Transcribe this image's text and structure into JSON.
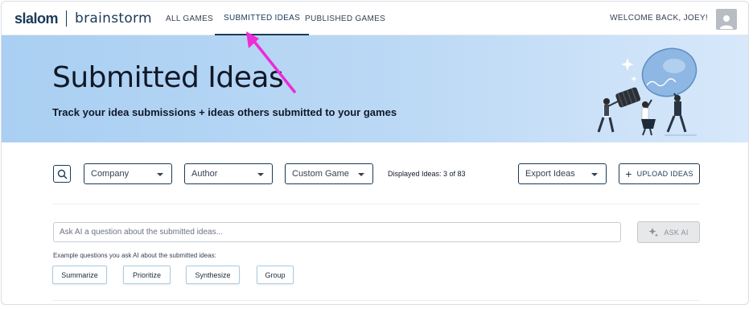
{
  "brand": {
    "name_left": "slalom",
    "name_right": "brainstorm"
  },
  "nav": {
    "tabs": [
      {
        "label": "ALL GAMES",
        "active": false
      },
      {
        "label": "SUBMITTED IDEAS",
        "active": true
      },
      {
        "label": "PUBLISHED GAMES",
        "active": false
      }
    ],
    "welcome": "WELCOME BACK, JOEY!",
    "avatar_icon": "user-avatar-icon"
  },
  "hero": {
    "title": "Submitted Ideas",
    "subtitle": "Track your idea submissions + ideas others submitted to your games",
    "illustration": "people-carrying-lightbulb"
  },
  "filters": {
    "search_icon": "search-icon",
    "company": "Company",
    "author": "Author",
    "game": "Custom Game",
    "displayed": "Displayed Ideas: 3 of 83",
    "export": "Export Ideas",
    "upload": "UPLOAD IDEAS"
  },
  "ask_ai": {
    "placeholder": "Ask AI a question about the submitted ideas...",
    "button": "ASK AI",
    "examples_label": "Example questions you ask AI about the submitted ideas:",
    "examples": [
      "Summarize",
      "Prioritize",
      "Synthesize",
      "Group"
    ]
  },
  "colors": {
    "brand_navy": "#1b3a57",
    "hero_blue": "#a9cff2",
    "annotation_magenta": "#ee2bd6",
    "chip_border": "#a9cbe5"
  }
}
